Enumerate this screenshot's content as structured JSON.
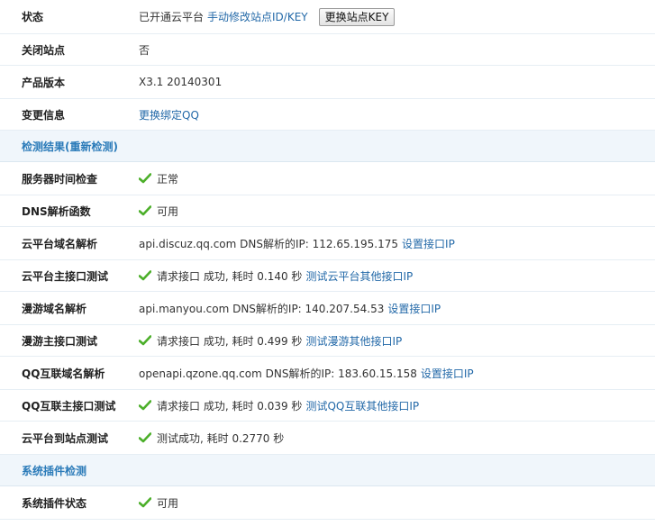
{
  "rows": {
    "status": {
      "label": "状态",
      "text": "已开通云平台",
      "link": "手动修改站点ID/KEY",
      "button": "更换站点KEY"
    },
    "close_site": {
      "label": "关闭站点",
      "text": "否"
    },
    "version": {
      "label": "产品版本",
      "text": "X3.1 20140301"
    },
    "change_info": {
      "label": "变更信息",
      "link": "更换绑定QQ"
    },
    "section_check": {
      "title": "检测结果(重新检测)"
    },
    "server_time": {
      "label": "服务器时间检查",
      "text": "正常"
    },
    "dns_func": {
      "label": "DNS解析函数",
      "text": "可用"
    },
    "cloud_dns": {
      "label": "云平台域名解析",
      "text": "api.discuz.qq.com DNS解析的IP: 112.65.195.175",
      "link": "设置接口IP"
    },
    "cloud_api": {
      "label": "云平台主接口测试",
      "text": "请求接口 成功, 耗时 0.140 秒",
      "link": "测试云平台其他接口IP"
    },
    "manyou_dns": {
      "label": "漫游域名解析",
      "text": "api.manyou.com DNS解析的IP: 140.207.54.53",
      "link": "设置接口IP"
    },
    "manyou_api": {
      "label": "漫游主接口测试",
      "text": "请求接口 成功, 耗时 0.499 秒",
      "link": "测试漫游其他接口IP"
    },
    "qq_dns": {
      "label": "QQ互联域名解析",
      "text": "openapi.qzone.qq.com DNS解析的IP: 183.60.15.158",
      "link": "设置接口IP"
    },
    "qq_api": {
      "label": "QQ互联主接口测试",
      "text": "请求接口 成功, 耗时 0.039 秒",
      "link": "测试QQ互联其他接口IP"
    },
    "cloud_to_site": {
      "label": "云平台到站点测试",
      "text": "测试成功, 耗时 0.2770 秒"
    },
    "section_plugin": {
      "title": "系统插件检测"
    },
    "plugin_status": {
      "label": "系统插件状态",
      "text": "可用"
    }
  },
  "colors": {
    "link": "#2369a8",
    "section_title": "#2b7bb9",
    "section_bg": "#f0f6fb",
    "check": "#4caf2a"
  },
  "icons": {
    "check": "check-icon"
  }
}
